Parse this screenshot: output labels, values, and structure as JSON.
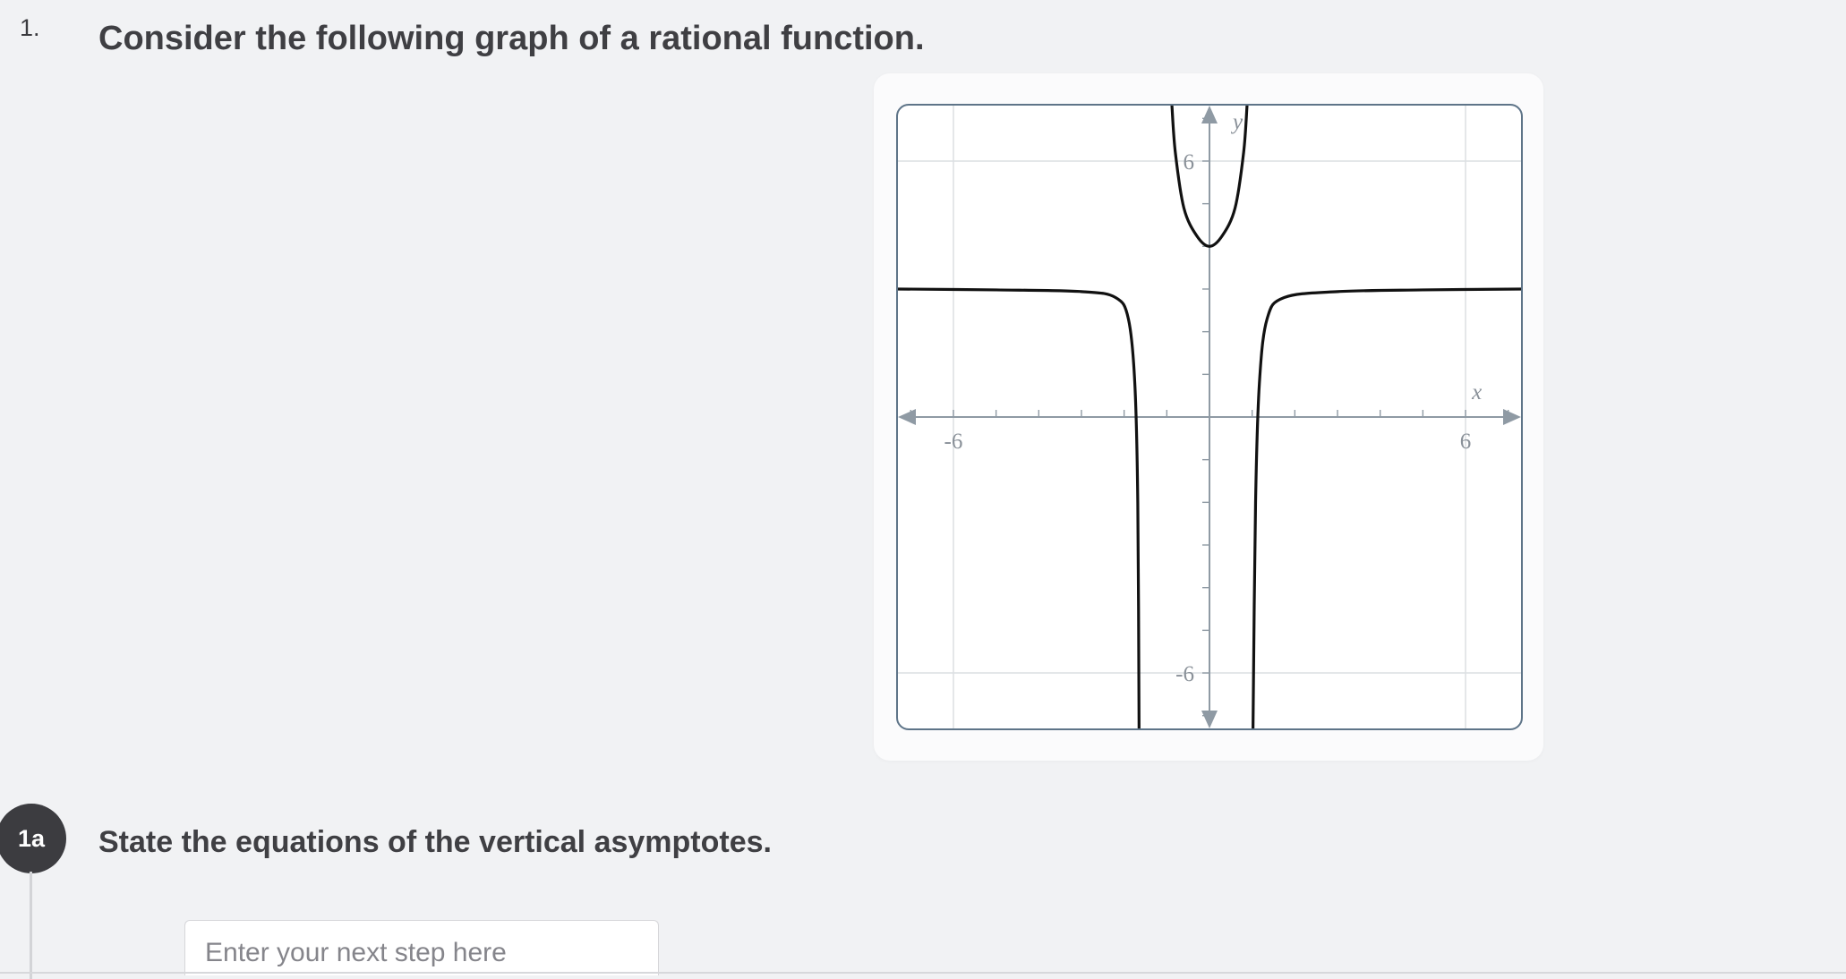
{
  "problem": {
    "number": "1.",
    "title": "Consider the following graph of a rational function."
  },
  "step": {
    "label": "1a",
    "question": "State the equations of the vertical asymptotes.",
    "input_placeholder": "Enter your next step here",
    "input_value": ""
  },
  "chart_data": {
    "type": "line",
    "title": "",
    "xlabel": "x",
    "ylabel": "y",
    "xlim": [
      -7.3,
      7.3
    ],
    "ylim": [
      -7.3,
      7.3
    ],
    "x_ticks_labeled": [
      "-6",
      "6"
    ],
    "y_ticks_labeled": [
      "6",
      "-6"
    ],
    "grid": true,
    "series": [
      {
        "points": [
          [
            -7.3,
            3.0
          ],
          [
            -5,
            2.98
          ],
          [
            -3,
            2.94
          ],
          [
            -2.2,
            2.8
          ],
          [
            -1.9,
            2.3
          ],
          [
            -1.75,
            0.8
          ],
          [
            -1.68,
            -2
          ],
          [
            -1.65,
            -7.3
          ]
        ]
      },
      {
        "points": [
          [
            -0.88,
            7.3
          ],
          [
            -0.8,
            6.2
          ],
          [
            -0.6,
            4.9
          ],
          [
            -0.3,
            4.25
          ],
          [
            0,
            4.0
          ],
          [
            0.3,
            4.25
          ],
          [
            0.6,
            4.9
          ],
          [
            0.8,
            6.2
          ],
          [
            0.88,
            7.3
          ]
        ]
      },
      {
        "points": [
          [
            1.02,
            -7.3
          ],
          [
            1.08,
            -2
          ],
          [
            1.17,
            0.8
          ],
          [
            1.35,
            2.3
          ],
          [
            1.75,
            2.8
          ],
          [
            3,
            2.94
          ],
          [
            5,
            2.98
          ],
          [
            7.3,
            3.0
          ]
        ]
      }
    ],
    "colors": {
      "curve": "#111111",
      "axis": "#8f9aa4",
      "grid": "#dcdfe2",
      "label": "#8a9199"
    }
  }
}
